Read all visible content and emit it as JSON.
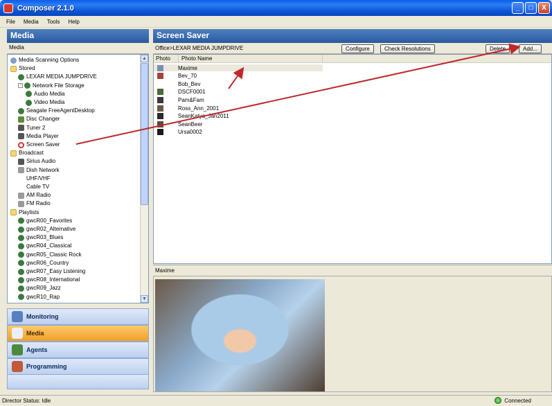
{
  "window": {
    "title": "Composer 2.1.0",
    "controls": [
      "_",
      "□",
      "X"
    ]
  },
  "menu": [
    "File",
    "Media",
    "Tools",
    "Help"
  ],
  "left": {
    "header": "Media",
    "subheader": "Media",
    "tree": [
      {
        "label": "Media Scanning Options",
        "icon": "gear",
        "indent": 0
      },
      {
        "label": "Stored",
        "icon": "folder",
        "indent": 0
      },
      {
        "label": "LEXAR MEDIA JUMPDRIVE",
        "icon": "note",
        "indent": 1
      },
      {
        "label": "Network File Storage",
        "icon": "note",
        "indent": 1,
        "expander": "-"
      },
      {
        "label": "Audio Media",
        "icon": "note",
        "indent": 2
      },
      {
        "label": "Video Media",
        "icon": "note",
        "indent": 2
      },
      {
        "label": "Seagate FreeAgentDesktop",
        "icon": "note",
        "indent": 1
      },
      {
        "label": "Disc Changer",
        "icon": "disk",
        "indent": 1
      },
      {
        "label": "Tuner 2",
        "icon": "tv",
        "indent": 1
      },
      {
        "label": "Media Player",
        "icon": "tv",
        "indent": 1
      },
      {
        "label": "Screen Saver",
        "icon": "ssaver",
        "indent": 1
      },
      {
        "label": "Broadcast",
        "icon": "folder",
        "indent": 0
      },
      {
        "label": "Sirius Audio",
        "icon": "tv",
        "indent": 1
      },
      {
        "label": "Dish Network",
        "icon": "radio",
        "indent": 1
      },
      {
        "label": "UHF/VHF",
        "icon": "blank",
        "indent": 1
      },
      {
        "label": "Cable TV",
        "icon": "blank",
        "indent": 1
      },
      {
        "label": "AM Radio",
        "icon": "radio",
        "indent": 1
      },
      {
        "label": "FM Radio",
        "icon": "radio",
        "indent": 1
      },
      {
        "label": "Playlists",
        "icon": "folder",
        "indent": 0
      },
      {
        "label": "gwcR00_Favorites",
        "icon": "note",
        "indent": 1
      },
      {
        "label": "gwcR02_Alternative",
        "icon": "note",
        "indent": 1
      },
      {
        "label": "gwcR03_Blues",
        "icon": "note",
        "indent": 1
      },
      {
        "label": "gwcR04_Classical",
        "icon": "note",
        "indent": 1
      },
      {
        "label": "gwcR05_Classic Rock",
        "icon": "note",
        "indent": 1
      },
      {
        "label": "gwcR06_Country",
        "icon": "note",
        "indent": 1
      },
      {
        "label": "gwcR07_Easy Listening",
        "icon": "note",
        "indent": 1
      },
      {
        "label": "gwcR08_International",
        "icon": "note",
        "indent": 1
      },
      {
        "label": "gwcR09_Jazz",
        "icon": "note",
        "indent": 1
      },
      {
        "label": "gwcR10_Rap",
        "icon": "note",
        "indent": 1
      }
    ],
    "nav": [
      {
        "label": "Monitoring",
        "active": false,
        "icon_color": "#5a7fc0"
      },
      {
        "label": "Media",
        "active": true,
        "icon_color": "#e8f0ff"
      },
      {
        "label": "Agents",
        "active": false,
        "icon_color": "#4a8a3a"
      },
      {
        "label": "Programming",
        "active": false,
        "icon_color": "#c05a3a"
      }
    ]
  },
  "right": {
    "header": "Screen Saver",
    "path": "Office>LEXAR MEDIA JUMPDRIVE",
    "buttons": {
      "configure": "Configure",
      "check": "Check Resolutions",
      "delete": "Delete",
      "add": "Add..."
    },
    "columns": [
      "Photo",
      "Photo Name"
    ],
    "photos": [
      {
        "name": "Maxime",
        "color": "#7a8fb0"
      },
      {
        "name": "Bev_70",
        "color": "#a0453a"
      },
      {
        "name": "Bob_Bev",
        "color": "#ffffff"
      },
      {
        "name": "DSCF0001",
        "color": "#4a6a3a"
      },
      {
        "name": "Pam&Fam",
        "color": "#3a3a3a"
      },
      {
        "name": "Ross_Ann_2001",
        "color": "#6a5a4a"
      },
      {
        "name": "SeanKatya_Jan2011",
        "color": "#2a2a2a"
      },
      {
        "name": "SeanBeer",
        "color": "#5a4a3a"
      },
      {
        "name": "Ursa0002",
        "color": "#1a1a1a"
      }
    ],
    "preview_label": "Maxime"
  },
  "status": {
    "left": "Director Status: Idle",
    "right": "Connected"
  },
  "colors": {
    "accent_arrow": "#c0282a",
    "active_nav": "#f5a830",
    "header_blue": "#2a5aa0"
  }
}
